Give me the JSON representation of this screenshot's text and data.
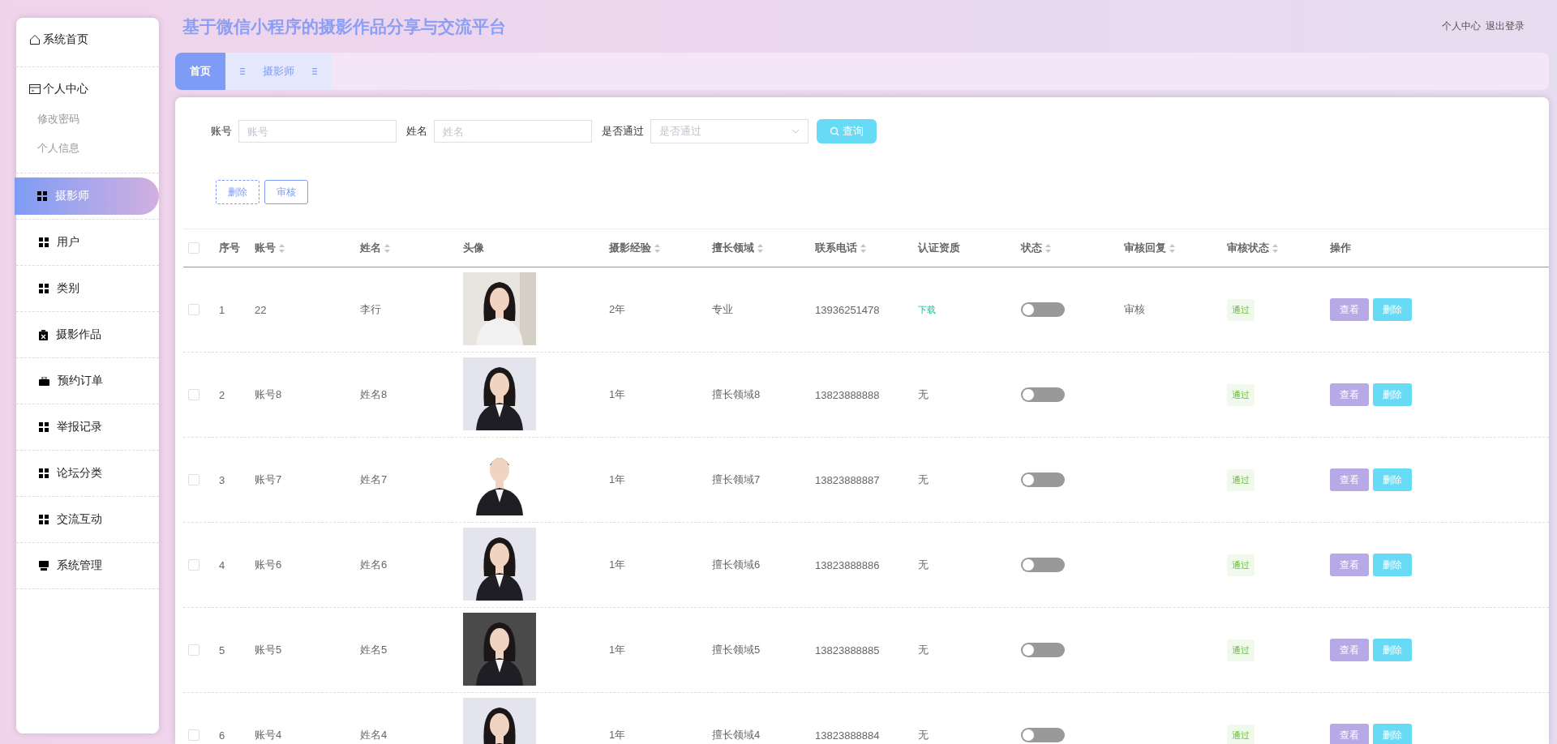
{
  "header": {
    "title": "基于微信小程序的摄影作品分享与交流平台",
    "links": [
      "个人中心",
      "退出登录"
    ]
  },
  "sidebar": {
    "items": [
      {
        "label": "系统首页",
        "selected": false
      },
      {
        "label": "个人中心",
        "selected": false,
        "children": [
          {
            "label": "修改密码"
          },
          {
            "label": "个人信息"
          }
        ]
      },
      {
        "label": "摄影师",
        "selected": true
      },
      {
        "label": "用户",
        "selected": false
      },
      {
        "label": "类别",
        "selected": false
      },
      {
        "label": "摄影作品",
        "selected": false
      },
      {
        "label": "预约订单",
        "selected": false
      },
      {
        "label": "举报记录",
        "selected": false
      },
      {
        "label": "论坛分类",
        "selected": false
      },
      {
        "label": "交流互动",
        "selected": false
      },
      {
        "label": "系统管理",
        "selected": false
      }
    ]
  },
  "tabs": [
    {
      "label": "首页",
      "selected": true
    },
    {
      "label": "摄影师",
      "selected": false
    }
  ],
  "filters": [
    {
      "label": "账号",
      "placeholder": "账号",
      "kind": "input"
    },
    {
      "label": "姓名",
      "placeholder": "姓名",
      "kind": "input"
    },
    {
      "label": "是否通过",
      "placeholder": "是否通过",
      "kind": "select"
    }
  ],
  "search_button": "查询",
  "actions": [
    {
      "label": "删除",
      "kind": "dashed"
    },
    {
      "label": "审核",
      "kind": "plain"
    }
  ],
  "table": {
    "all_checked": false,
    "columns": [
      {
        "label": "序号",
        "sortable": false
      },
      {
        "label": "账号",
        "sortable": true
      },
      {
        "label": "姓名",
        "sortable": true
      },
      {
        "label": "头像",
        "sortable": false
      },
      {
        "label": "摄影经验",
        "sortable": true
      },
      {
        "label": "擅长领域",
        "sortable": true
      },
      {
        "label": "联系电话",
        "sortable": true
      },
      {
        "label": "认证资质",
        "sortable": false
      },
      {
        "label": "状态",
        "sortable": true
      },
      {
        "label": "审核回复",
        "sortable": true
      },
      {
        "label": "审核状态",
        "sortable": true
      },
      {
        "label": "操作",
        "sortable": false
      }
    ],
    "rows": [
      {
        "index": "1",
        "account": "22",
        "name": "李行",
        "experience": "2年",
        "field": "专业",
        "phone": "13936251478",
        "cert": "下载",
        "cert_is_link": true,
        "on": false,
        "reply": "审核",
        "status": "通过",
        "checked": false,
        "buttons": [
          "查看",
          "删除"
        ]
      },
      {
        "index": "2",
        "account": "账号8",
        "name": "姓名8",
        "experience": "1年",
        "field": "擅长领域8",
        "phone": "13823888888",
        "cert": "无",
        "cert_is_link": false,
        "on": false,
        "status": "通过",
        "checked": false,
        "buttons": [
          "查看",
          "删除"
        ]
      },
      {
        "index": "3",
        "account": "账号7",
        "name": "姓名7",
        "experience": "1年",
        "field": "擅长领域7",
        "phone": "13823888887",
        "cert": "无",
        "cert_is_link": false,
        "on": false,
        "status": "通过",
        "checked": false,
        "buttons": [
          "查看",
          "删除"
        ]
      },
      {
        "index": "4",
        "account": "账号6",
        "name": "姓名6",
        "experience": "1年",
        "field": "擅长领域6",
        "phone": "13823888886",
        "cert": "无",
        "cert_is_link": false,
        "on": false,
        "status": "通过",
        "checked": false,
        "buttons": [
          "查看",
          "删除"
        ]
      },
      {
        "index": "5",
        "account": "账号5",
        "name": "姓名5",
        "experience": "1年",
        "field": "擅长领域5",
        "phone": "13823888885",
        "cert": "无",
        "cert_is_link": false,
        "on": false,
        "status": "通过",
        "checked": false,
        "buttons": [
          "查看",
          "删除"
        ]
      },
      {
        "index": "6",
        "account": "账号4",
        "name": "姓名4",
        "experience": "1年",
        "field": "擅长领域4",
        "phone": "13823888884",
        "cert": "无",
        "cert_is_link": false,
        "on": false,
        "status": "通过",
        "checked": false,
        "buttons": [
          "查看",
          "删除"
        ]
      }
    ]
  }
}
